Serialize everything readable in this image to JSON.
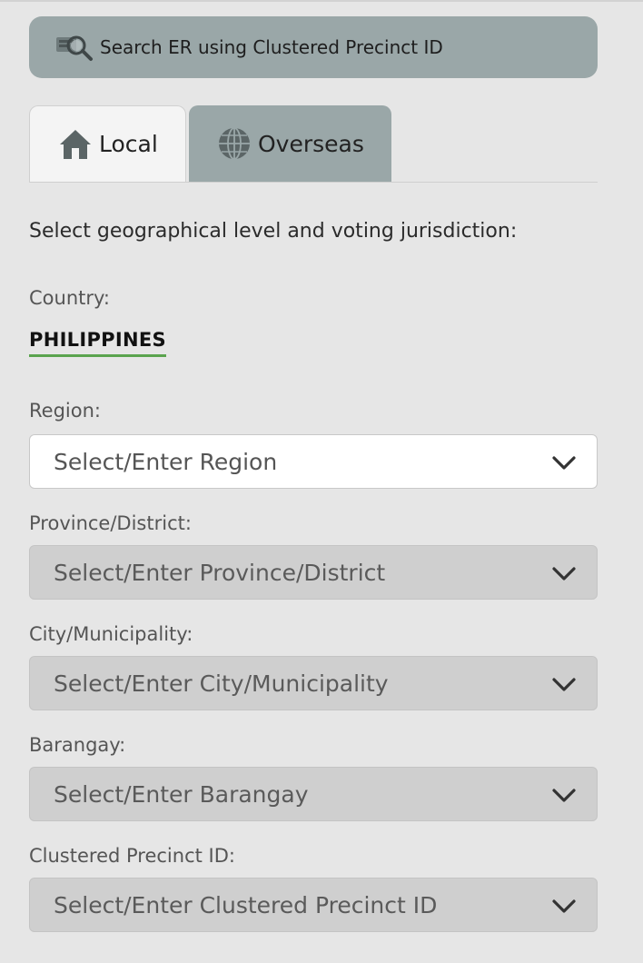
{
  "search_button": {
    "label": "Search ER using Clustered Precinct ID",
    "icon": "search-file-icon"
  },
  "tabs": [
    {
      "label": "Local",
      "icon": "house-icon",
      "active": true
    },
    {
      "label": "Overseas",
      "icon": "globe-icon",
      "active": false
    }
  ],
  "instruction": "Select geographical level and voting jurisdiction:",
  "country": {
    "label": "Country:",
    "value": "PHILIPPINES"
  },
  "fields": {
    "region": {
      "label": "Region:",
      "placeholder": "Select/Enter Region",
      "enabled": true
    },
    "province": {
      "label": "Province/District:",
      "placeholder": "Select/Enter Province/District",
      "enabled": false
    },
    "city": {
      "label": "City/Municipality:",
      "placeholder": "Select/Enter City/Municipality",
      "enabled": false
    },
    "barangay": {
      "label": "Barangay:",
      "placeholder": "Select/Enter Barangay",
      "enabled": false
    },
    "precinct": {
      "label": "Clustered Precinct ID:",
      "placeholder": "Select/Enter Clustered Precinct ID",
      "enabled": false
    }
  },
  "colors": {
    "accent_green": "#5aa34e",
    "button_gray": "#9aa7a8",
    "disabled_gray": "#cfcfcf",
    "page_bg": "#e6e6e6"
  }
}
